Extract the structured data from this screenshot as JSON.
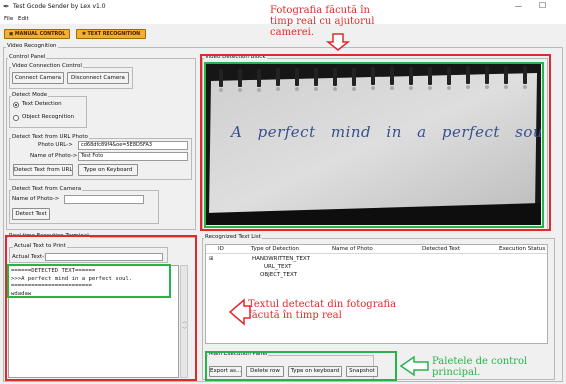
{
  "window": {
    "title": "Test Gcode Sender by Lex v1.0",
    "controls": {
      "minimize": "—",
      "maximize": "☐"
    }
  },
  "menubar": {
    "items": [
      "File",
      "Edit"
    ]
  },
  "top_tabs": {
    "manual": "MANUAL CONTROL",
    "text": "TEXT RECOGNITION"
  },
  "video_recognition": {
    "title": "Video Recognition",
    "control_panel": "Control Panel",
    "connection": {
      "title": "Video Connection Control",
      "connect": "Connect Camera",
      "disconnect": "Disconnect Camera"
    },
    "detect_mode": {
      "title": "Detect Mode",
      "options": [
        "Text  Detection",
        "Object Recognition"
      ],
      "selected": 0
    },
    "url_photo": {
      "title": "Detect Text from URL Photo",
      "photo_url_label": "Photo URL->",
      "photo_url_value": "cd68dfc89f4&oe=5E8D5FA3",
      "name_label": "Name of Photo->",
      "name_value": "Test Foto",
      "detect_button": "Detect Text from URL",
      "keyboard_button": "Type on Keyboard"
    },
    "camera": {
      "title": "Detect Text from Camera",
      "name_label": "Name of Photo->",
      "name_value": "",
      "detect_button": "Detect Text"
    }
  },
  "terminal": {
    "title": "Real time Execution Terminal",
    "actual_print_label": "Actual Text to Print",
    "actual_text_label": "Actual Text->",
    "actual_text_value": "",
    "lines": [
      "======DETECTED TEXT======",
      ">>>A perfect mind in a perfect soul.",
      "========================",
      "wdadaw"
    ]
  },
  "video_detection": {
    "title": "Video Detection Block",
    "handwriting": "A perfect mind in a perfect soul."
  },
  "recognized": {
    "title": "Recognized Text List",
    "columns": [
      "ID",
      "Type of Detection",
      "Name of Photo",
      "Detected Text",
      "Execution Status"
    ],
    "rows": [
      {
        "expander": "⊞",
        "type": "HANDWRITTEN_TEXT"
      },
      {
        "expander": "",
        "type": "URL_TEXT"
      },
      {
        "expander": "",
        "type": "OBJECT_TEXT"
      }
    ]
  },
  "main_panel": {
    "title": "Main Execution Panel",
    "buttons": [
      "Export as...",
      "Delete row",
      "Type on keyboard",
      "Snapshot"
    ]
  },
  "annotations": {
    "camera": [
      "Fotografia făcută în",
      "timp real cu ajutorul",
      "camerei."
    ],
    "detected": [
      "Textul detectat din fotografia",
      "făcută în timp real"
    ],
    "control": [
      "Paletele de control",
      "principal."
    ]
  },
  "colors": {
    "annotation_red": "#e02a2a",
    "annotation_green": "#27b34a",
    "tab_orange": "#f3b02f",
    "terminal_text": "#1a1a1a"
  }
}
